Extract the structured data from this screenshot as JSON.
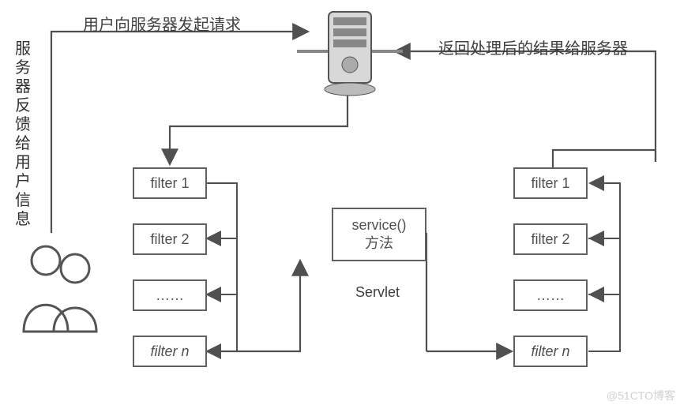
{
  "labels": {
    "request": "用户向服务器发起请求",
    "response_back": "返回处理后的结果给服务器",
    "feedback_vertical": "服务器反馈给用户信息",
    "servlet_caption": "Servlet"
  },
  "left_filters": {
    "f1": "filter 1",
    "f2": "filter 2",
    "ellipsis": "……",
    "fn": "filter n"
  },
  "right_filters": {
    "f1": "filter 1",
    "f2": "filter 2",
    "ellipsis": "……",
    "fn": "filter n"
  },
  "service_box": {
    "line1": "service()",
    "line2": "方法"
  },
  "watermark": "@51CTO博客"
}
